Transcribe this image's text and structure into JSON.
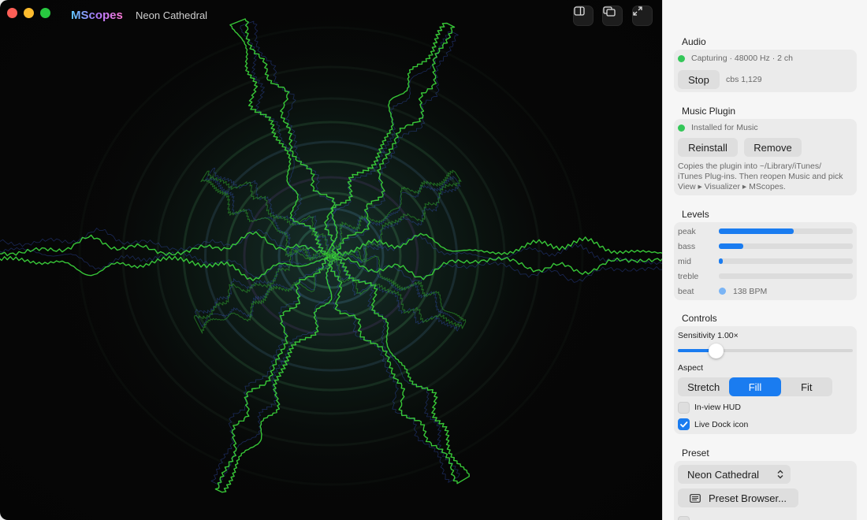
{
  "window": {
    "app_name": "MScopes",
    "preset_name": "Neon Cathedral"
  },
  "sidebar": {
    "audio": {
      "heading": "Audio",
      "status": "Capturing · 48000 Hz · 2 ch",
      "stop_label": "Stop",
      "cbs": "cbs 1,129"
    },
    "plugin": {
      "heading": "Music Plugin",
      "status": "Installed for Music",
      "reinstall_label": "Reinstall",
      "remove_label": "Remove",
      "help_line1": "Copies the plugin into ~/Library/iTunes/",
      "help_line2": "iTunes Plug-ins. Then reopen Music and pick",
      "help_line3": "View ▸ Visualizer ▸ MScopes."
    },
    "levels": {
      "heading": "Levels",
      "items": [
        {
          "label": "peak",
          "value": 0.56
        },
        {
          "label": "bass",
          "value": 0.18
        },
        {
          "label": "mid",
          "value": 0.03
        },
        {
          "label": "treble",
          "value": 0.0
        }
      ],
      "beat_label": "beat",
      "bpm": "138 BPM"
    },
    "controls": {
      "heading": "Controls",
      "sensitivity_label": "Sensitivity 1.00×",
      "sensitivity_value": 0.22,
      "aspect_label": "Aspect",
      "aspect_options": [
        "Stretch",
        "Fill",
        "Fit"
      ],
      "aspect_selected": "Fill",
      "hud_label": "In-view HUD",
      "hud_checked": false,
      "dock_label": "Live Dock icon",
      "dock_checked": true
    },
    "preset": {
      "heading": "Preset",
      "selected": "Neon Cathedral",
      "browser_label": "Preset Browser..."
    }
  },
  "colors": {
    "accent": "#1a7cf0",
    "status_green": "#34c759",
    "beat_dot": "#7ab4f5",
    "viz_line": "#3ad13a"
  }
}
